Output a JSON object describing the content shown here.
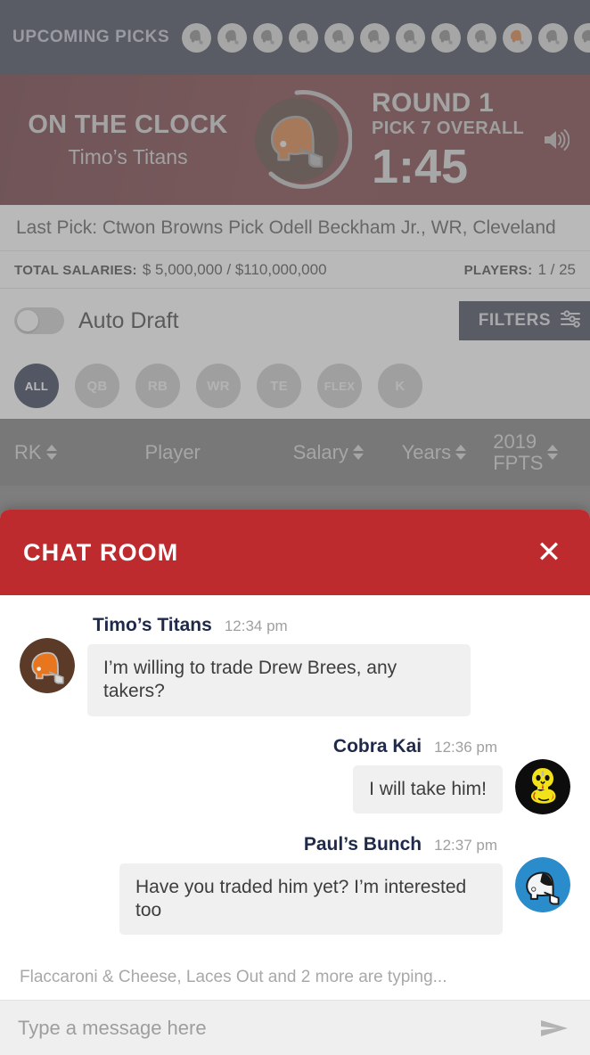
{
  "upcoming": {
    "label": "UPCOMING PICKS",
    "avatars": [
      {
        "name": "pick-avatar-1",
        "color": "#7d7d7d"
      },
      {
        "name": "pick-avatar-2",
        "color": "#7d7d7d"
      },
      {
        "name": "pick-avatar-3",
        "color": "#7d7d7d"
      },
      {
        "name": "pick-avatar-4",
        "color": "#7d7d7d"
      },
      {
        "name": "pick-avatar-5",
        "color": "#7d7d7d"
      },
      {
        "name": "pick-avatar-6",
        "color": "#7d7d7d"
      },
      {
        "name": "pick-avatar-7",
        "color": "#7d7d7d"
      },
      {
        "name": "pick-avatar-8",
        "color": "#7d7d7d"
      },
      {
        "name": "pick-avatar-9",
        "color": "#7d7d7d"
      },
      {
        "name": "pick-avatar-10",
        "color": "#d2722b"
      },
      {
        "name": "pick-avatar-11",
        "color": "#7d7d7d"
      },
      {
        "name": "pick-avatar-12",
        "color": "#7d7d7d"
      }
    ]
  },
  "clock": {
    "status": "ON THE CLOCK",
    "team": "Timo’s Titans",
    "round": "ROUND 1",
    "pick_overall": "PICK 7 OVERALL",
    "timer": "1:45",
    "sound_icon": "speaker-icon",
    "logo_icon": "browns-helmet-icon",
    "band_color": "#6e2a30",
    "progress_ring_color": "#b9b9b9"
  },
  "lastpick": {
    "text": "Last Pick: Ctwon Browns Pick Odell Beckham Jr., WR, Cleveland"
  },
  "salaries": {
    "total_label": "TOTAL SALARIES:",
    "total_value": "$ 5,000,000 / $110,000,000",
    "players_label": "PLAYERS:",
    "players_value": "1 / 25"
  },
  "controls": {
    "auto_draft_label": "Auto Draft",
    "auto_draft_on": false,
    "filters_label": "FILTERS",
    "filters_icon": "tune-sliders-icon"
  },
  "positions": [
    {
      "label": "ALL",
      "selected": true
    },
    {
      "label": "QB",
      "selected": false
    },
    {
      "label": "RB",
      "selected": false
    },
    {
      "label": "WR",
      "selected": false
    },
    {
      "label": "TE",
      "selected": false
    },
    {
      "label": "FLEX",
      "selected": false
    },
    {
      "label": "K",
      "selected": false
    }
  ],
  "table": {
    "columns": [
      {
        "label": "RK",
        "sortable": true
      },
      {
        "label": "Player",
        "sortable": false
      },
      {
        "label": "Salary",
        "sortable": true
      },
      {
        "label": "Years",
        "sortable": true
      },
      {
        "label": "2019",
        "label2": "FPTS",
        "sortable": true
      }
    ]
  },
  "chat": {
    "title": "CHAT ROOM",
    "close_icon": "close-icon",
    "messages": [
      {
        "name": "Timo’s Titans",
        "time": "12:34 pm",
        "text": "I’m willing to trade Drew Brees, any takers?",
        "side": "left",
        "avatar": "browns-helmet-avatar"
      },
      {
        "name": "Cobra Kai",
        "time": "12:36 pm",
        "text": "I will take him!",
        "side": "right",
        "avatar": "cobra-avatar"
      },
      {
        "name": "Paul’s Bunch",
        "time": "12:37 pm",
        "text": "Have you traded him yet? I’m interested too",
        "side": "right",
        "avatar": "panthers-helmet-avatar"
      }
    ],
    "typing": "Flaccaroni & Cheese, Laces Out and 2 more are typing...",
    "input_value": "",
    "input_placeholder": "Type a message here",
    "send_icon": "send-icon",
    "header_color": "#bd2b2f"
  }
}
